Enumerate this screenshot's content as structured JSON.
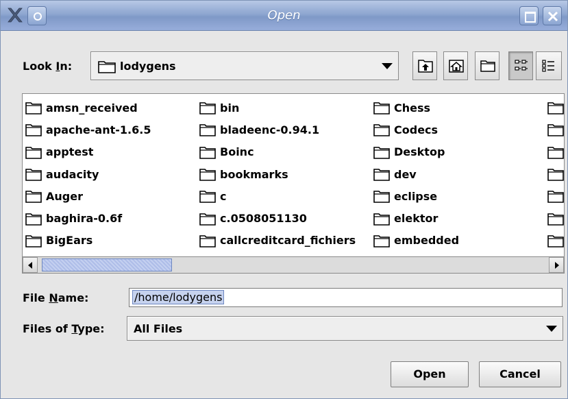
{
  "window": {
    "title": "Open"
  },
  "look_in": {
    "label_prefix": "Look ",
    "label_mnemonic": "I",
    "label_suffix": "n:",
    "value": "lodygens"
  },
  "toolbar": {
    "icons": [
      "up-one-level-icon",
      "home-icon",
      "new-folder-icon",
      "list-view-icon",
      "details-view-icon"
    ]
  },
  "files": {
    "columns": [
      [
        "amsn_received",
        "apache-ant-1.6.5",
        "apptest",
        "audacity",
        "Auger",
        "baghira-0.6f",
        "BigEars"
      ],
      [
        "bin",
        "bladeenc-0.94.1",
        "Boinc",
        "bookmarks",
        "c",
        "c.0508051130",
        "callcreditcard_fichiers"
      ],
      [
        "Chess",
        "Codecs",
        "Desktop",
        "dev",
        "eclipse",
        "elektor",
        "embedded"
      ]
    ],
    "icon": "folder-icon"
  },
  "file_name": {
    "label_prefix": "File ",
    "label_mnemonic": "N",
    "label_suffix": "ame:",
    "value": "/home/lodygens"
  },
  "file_type": {
    "label_prefix": "Files of ",
    "label_mnemonic": "T",
    "label_suffix": "ype:",
    "value": "All Files"
  },
  "buttons": {
    "open": "Open",
    "cancel": "Cancel"
  },
  "colors": {
    "titlebar": "#8ea6d0",
    "background": "#e6e6e6",
    "scroll_thumb": "#aebde8"
  }
}
